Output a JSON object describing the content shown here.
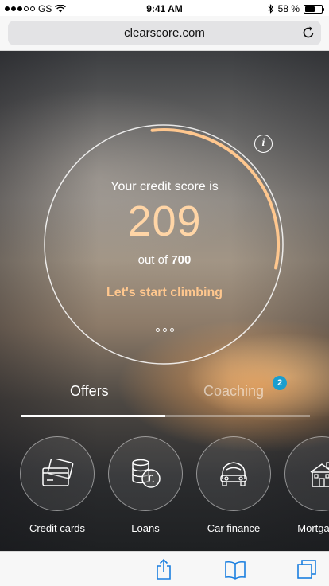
{
  "status": {
    "carrier": "GS",
    "time": "9:41 AM",
    "battery": "58 %",
    "battery_level": 0.58,
    "signal_bars": 3,
    "signal_total": 5
  },
  "browser": {
    "url": "clearscore.com"
  },
  "score": {
    "label": "Your credit score is",
    "value": "209",
    "out_of_prefix": "out of",
    "max": "700",
    "fraction": 0.2986,
    "cta": "Let's start climbing"
  },
  "tabs": [
    {
      "label": "Offers",
      "active": true
    },
    {
      "label": "Coaching",
      "active": false,
      "badge": "2"
    }
  ],
  "categories": [
    {
      "label": "Credit cards",
      "icon": "credit-card-icon"
    },
    {
      "label": "Loans",
      "icon": "pound-coins-icon"
    },
    {
      "label": "Car finance",
      "icon": "car-icon"
    },
    {
      "label": "Mortgages",
      "icon": "house-icon"
    }
  ],
  "colors": {
    "score": "#ffd5a6",
    "arc": "#ffc78e",
    "badge": "#1a9ecf"
  }
}
